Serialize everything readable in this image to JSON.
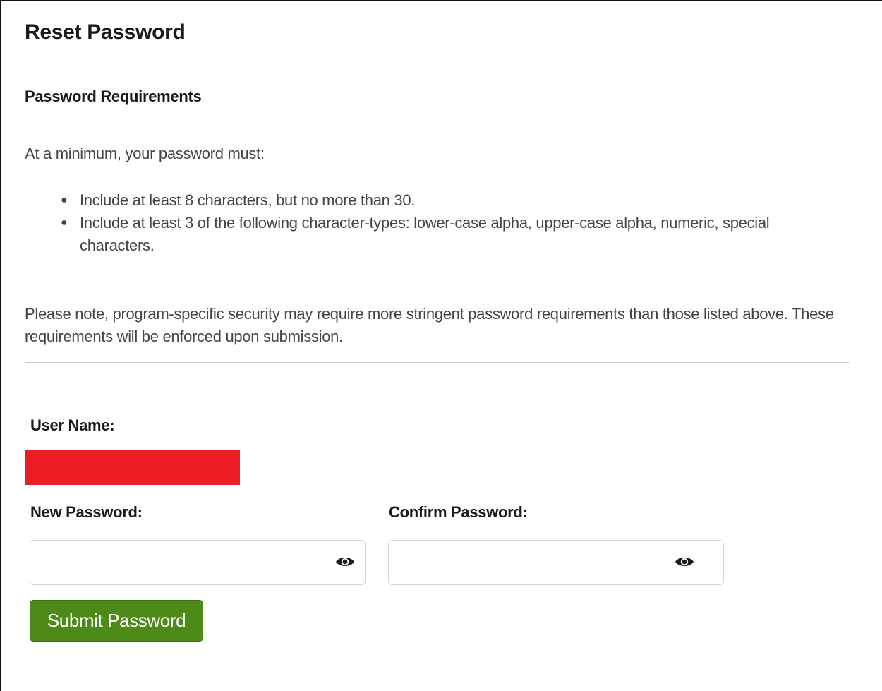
{
  "page": {
    "title": "Reset Password"
  },
  "requirements": {
    "heading": "Password Requirements",
    "intro": "At a minimum, your password must:",
    "items": [
      "Include at least 8 characters, but no more than 30.",
      "Include at least 3 of the following character-types: lower-case alpha, upper-case alpha, numeric, special characters."
    ],
    "note": "Please note, program-specific security may require more stringent password requirements than those listed above. These requirements will be enforced upon submission."
  },
  "form": {
    "username_label": "User Name:",
    "username_value_redacted_color": "#ec1c24",
    "new_password_label": "New Password:",
    "new_password_value": "",
    "confirm_password_label": "Confirm Password:",
    "confirm_password_value": "",
    "show_password_icon": "eye-icon",
    "submit_label": "Submit Password",
    "submit_color": "#4e8a18"
  }
}
